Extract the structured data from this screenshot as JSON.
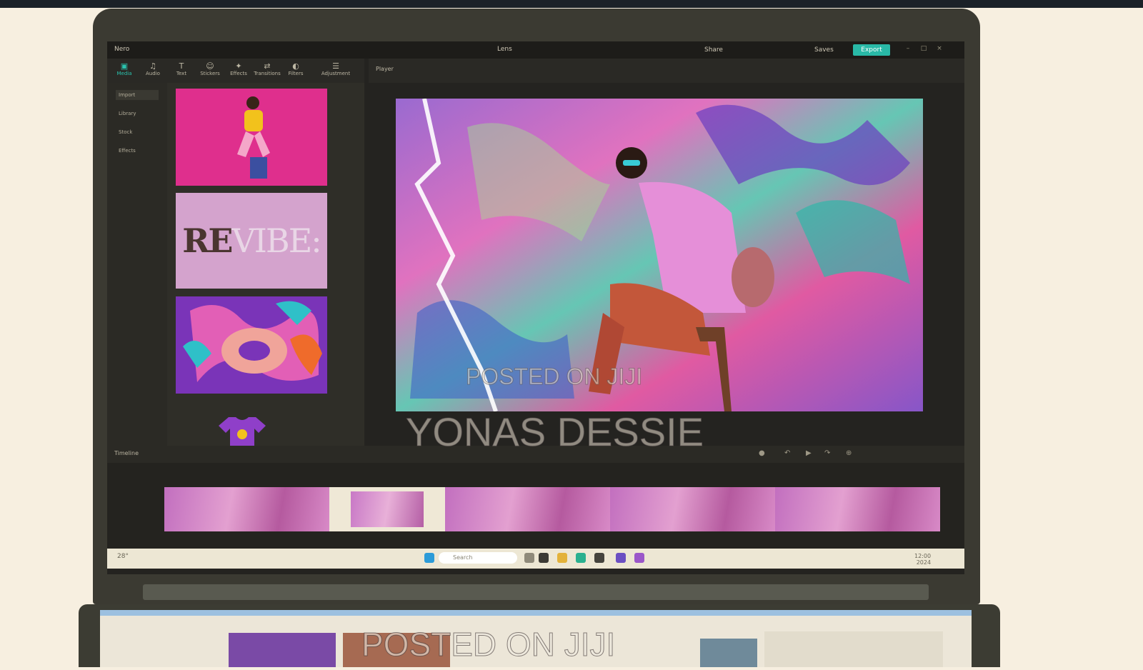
{
  "app": {
    "logo": "Nero",
    "doc_title": "Lens",
    "btn_a": "Share",
    "btn_b": "Saves",
    "export": "Export"
  },
  "toolbar": {
    "tools": [
      {
        "label": "Media",
        "icon": "▣"
      },
      {
        "label": "Audio",
        "icon": "♫"
      },
      {
        "label": "Text",
        "icon": "T"
      },
      {
        "label": "Stickers",
        "icon": "☺"
      },
      {
        "label": "Effects",
        "icon": "✦"
      },
      {
        "label": "Transitions",
        "icon": "⇄"
      },
      {
        "label": "Filters",
        "icon": "◐"
      },
      {
        "label": "Adjustment",
        "icon": "☰"
      }
    ]
  },
  "preview": {
    "label": "Player"
  },
  "left_nav": {
    "items": [
      "Import",
      "Library",
      "Stock",
      "Effects"
    ]
  },
  "media": {
    "thumb2_text_a": "RE",
    "thumb2_text_b": "VIBE:"
  },
  "timeline": {
    "label": "Timeline"
  },
  "taskbar": {
    "search_placeholder": "Search",
    "weather": "28°",
    "time": "12:00",
    "date": "2024"
  },
  "watermarks": {
    "line1": "POSTED ON JIJI",
    "line2": "YONAS DESSIE",
    "line3": "POSTED ON JIJI"
  },
  "colors": {
    "accent": "#29b9a7",
    "background": "#f7efe0"
  }
}
